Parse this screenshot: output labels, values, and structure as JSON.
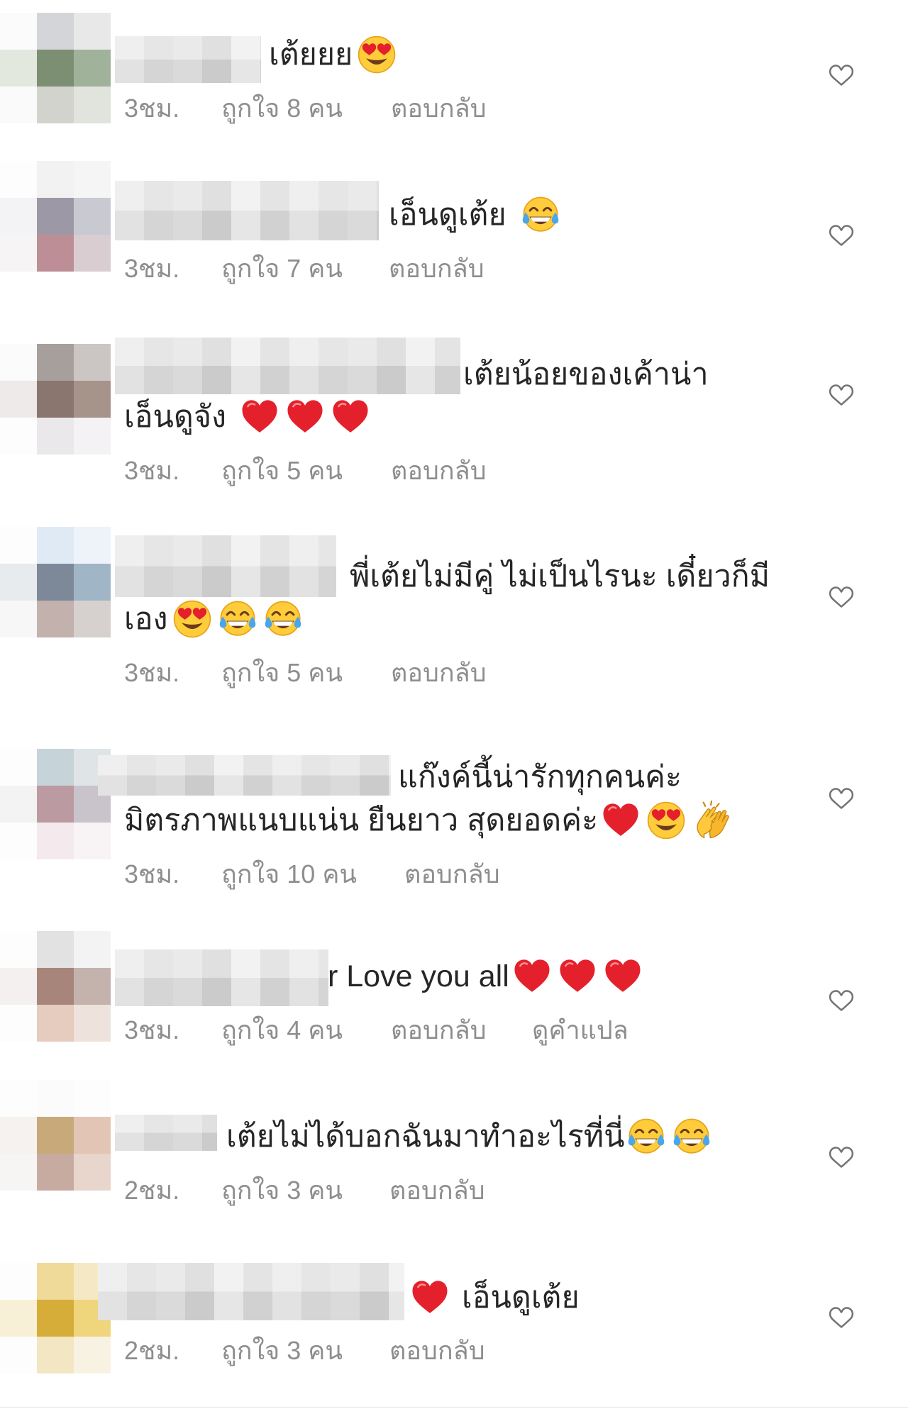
{
  "colors": {
    "text": "#262626",
    "meta": "#8e8e8e",
    "like_icon": "#737373",
    "heart_emoji": "#e3202c"
  },
  "like_icon": "heart-outline",
  "comments": [
    {
      "avatar_tiles": [
        "#fbfbfb",
        "#d4d5d8",
        "#e8e8e8",
        "#e3e8df",
        "#7c8f72",
        "#a1b29a",
        "#fafafa",
        "#d2d3cc",
        "#e1e3dd"
      ],
      "lines": [
        {
          "text": "เต้ยยย",
          "emoji": [
            "smiling-face-with-heart-eyes"
          ]
        }
      ],
      "time": "3ชม.",
      "likes": "ถูกใจ 8 คน",
      "reply_label": "ตอบกลับ"
    },
    {
      "avatar_tiles": [
        "#fdfdfd",
        "#f2f2f3",
        "#f5f5f6",
        "#f3f3f5",
        "#9d98a6",
        "#c9c9d1",
        "#f6f4f5",
        "#be8e97",
        "#d9cdd2"
      ],
      "lines": [
        {
          "text": "เอ็นดูเต้ย",
          "emoji": [
            "face-with-tears-of-joy"
          ]
        }
      ],
      "time": "3ชม.",
      "likes": "ถูกใจ 7 คน",
      "reply_label": "ตอบกลับ"
    },
    {
      "avatar_tiles": [
        "#fbfbfb",
        "#a79f9b",
        "#cbc6c4",
        "#eeeaea",
        "#8b766f",
        "#a69389",
        "#fdfdfd",
        "#ebe8eb",
        "#f4f2f4"
      ],
      "lines": [
        {
          "text": "เต้ยน้อยของเค้าน่า"
        },
        {
          "text": "เอ็นดูจัง",
          "emoji": [
            "red-heart",
            "red-heart",
            "red-heart"
          ]
        }
      ],
      "time": "3ชม.",
      "likes": "ถูกใจ 5 คน",
      "reply_label": "ตอบกลับ"
    },
    {
      "avatar_tiles": [
        "#fdfdfd",
        "#dfeaf5",
        "#eef3f9",
        "#e8ebee",
        "#7d8898",
        "#a0b6c7",
        "#f7f7f7",
        "#c2b1ac",
        "#d6d1ce"
      ],
      "lines": [
        {
          "text": "พี่เต้ยไม่มีคู่ ไม่เป็นไรนะ เดี๋ยวก็มี"
        },
        {
          "text": "เอง",
          "emoji": [
            "smiling-face-with-heart-eyes",
            "face-with-tears-of-joy",
            "face-with-tears-of-joy"
          ]
        }
      ],
      "time": "3ชม.",
      "likes": "ถูกใจ 5 คน",
      "reply_label": "ตอบกลับ"
    },
    {
      "avatar_tiles": [
        "#fdfdfd",
        "#c6d3d9",
        "#dfe5e7",
        "#f4f3f4",
        "#bb9aa2",
        "#c9c4cb",
        "#fdfdfd",
        "#f4e9ed",
        "#f8f4f6"
      ],
      "lines": [
        {
          "text": "แก๊งค์นี้น่ารักทุกคนค่ะ"
        },
        {
          "text": "มิตรภาพแนบแน่น ยืนยาว สุดยอดค่ะ",
          "emoji": [
            "red-heart",
            "smiling-face-with-heart-eyes",
            "clapping-hands"
          ]
        }
      ],
      "time": "3ชม.",
      "likes": "ถูกใจ 10 คน",
      "reply_label": "ตอบกลับ"
    },
    {
      "avatar_tiles": [
        "#fdfdfd",
        "#e2e2e2",
        "#f3f3f3",
        "#f3f0ef",
        "#a8857b",
        "#c4b3ad",
        "#fdfdfd",
        "#e6cbbf",
        "#ede2dc"
      ],
      "lines": [
        {
          "text": "r Love you all",
          "emoji": [
            "red-heart",
            "red-heart",
            "red-heart"
          ]
        }
      ],
      "time": "3ชม.",
      "likes": "ถูกใจ 4 คน",
      "reply_label": "ตอบกลับ",
      "translate_label": "ดูคำแปล"
    },
    {
      "avatar_tiles": [
        "#fdfdfd",
        "#fbfbfb",
        "#fdfdfd",
        "#f5f2f0",
        "#c7a97a",
        "#e2c5b5",
        "#f7f5f4",
        "#c7aba0",
        "#e8d5cb"
      ],
      "lines": [
        {
          "text": "เต้ยไม่ได้บอกฉันมาทำอะไรที่นี่",
          "emoji": [
            "face-with-tears-of-joy",
            "face-with-tears-of-joy"
          ]
        }
      ],
      "time": "2ชม.",
      "likes": "ถูกใจ 3 คน",
      "reply_label": "ตอบกลับ"
    },
    {
      "avatar_tiles": [
        "#fdfdfd",
        "#f0da9a",
        "#f5e9c5",
        "#f7f0d6",
        "#d5ad38",
        "#efd57c",
        "#fdfdfd",
        "#f3e6c2",
        "#f8f2e2"
      ],
      "lines": [
        {
          "emoji": [
            "red-heart"
          ],
          "text": "เอ็นดูเต้ย"
        }
      ],
      "time": "2ชม.",
      "likes": "ถูกใจ 3 คน",
      "reply_label": "ตอบกลับ"
    }
  ]
}
